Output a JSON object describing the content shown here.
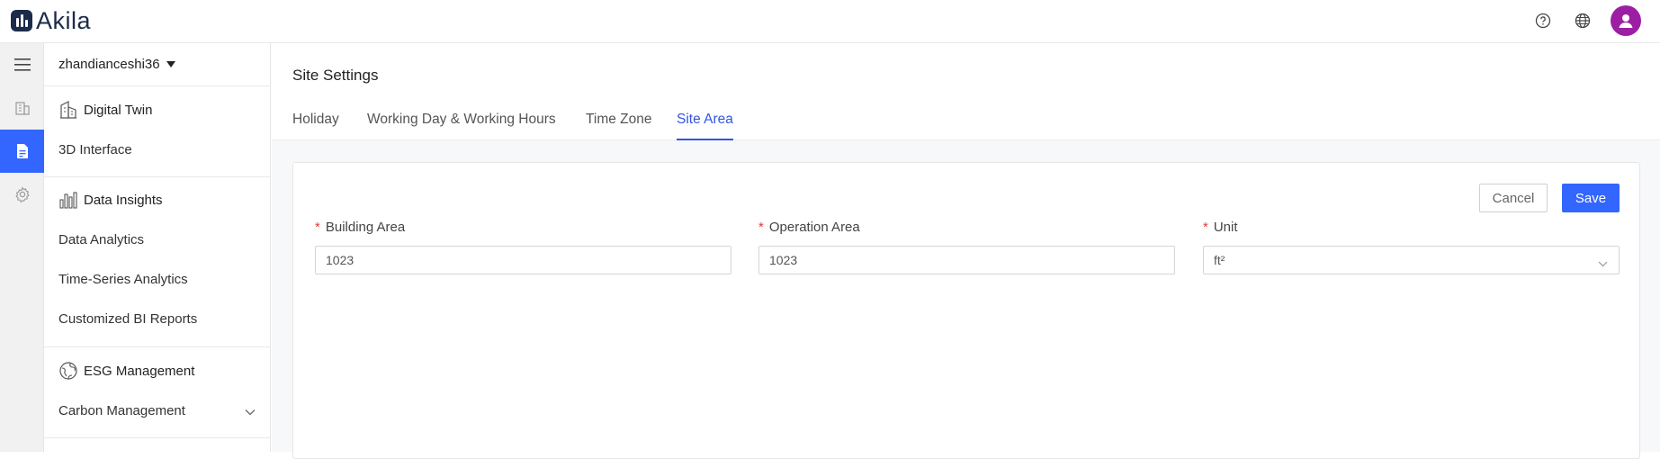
{
  "brand": {
    "name": "Akila"
  },
  "topbar": {
    "icons": [
      "help-circle-icon",
      "globe-icon",
      "user-avatar-icon"
    ]
  },
  "rail": {
    "items": [
      "menu-icon",
      "building-icon",
      "site-document-icon",
      "gear-icon"
    ],
    "active_index": 2
  },
  "nav": {
    "site_name": "zhandianceshi36",
    "groups": [
      {
        "title": "Digital Twin",
        "icon": "building-outline-icon",
        "items": [
          "3D Interface"
        ]
      },
      {
        "title": "Data Insights",
        "icon": "bar-chart-icon",
        "items": [
          "Data Analytics",
          "Time-Series Analytics",
          "Customized BI Reports"
        ]
      },
      {
        "title": "ESG Management",
        "icon": "globe-leaf-icon",
        "items": [
          "Carbon Management"
        ]
      }
    ]
  },
  "main": {
    "title": "Site Settings",
    "tabs": [
      "Holiday",
      "Working Day & Working Hours",
      "Time Zone",
      "Site Area"
    ],
    "active_tab": "Site Area",
    "actions": {
      "cancel": "Cancel",
      "save": "Save"
    },
    "fields": [
      {
        "label": "Building Area",
        "value": "1023",
        "required": "*"
      },
      {
        "label": "Operation Area",
        "value": "1023",
        "required": "*"
      },
      {
        "label": "Unit",
        "value": "ft²",
        "required": "*"
      }
    ]
  },
  "colors": {
    "accent": "#3366ff",
    "avatar": "#9c1fa3",
    "required": "#e33b3b",
    "brand": "#1d2b4a"
  }
}
